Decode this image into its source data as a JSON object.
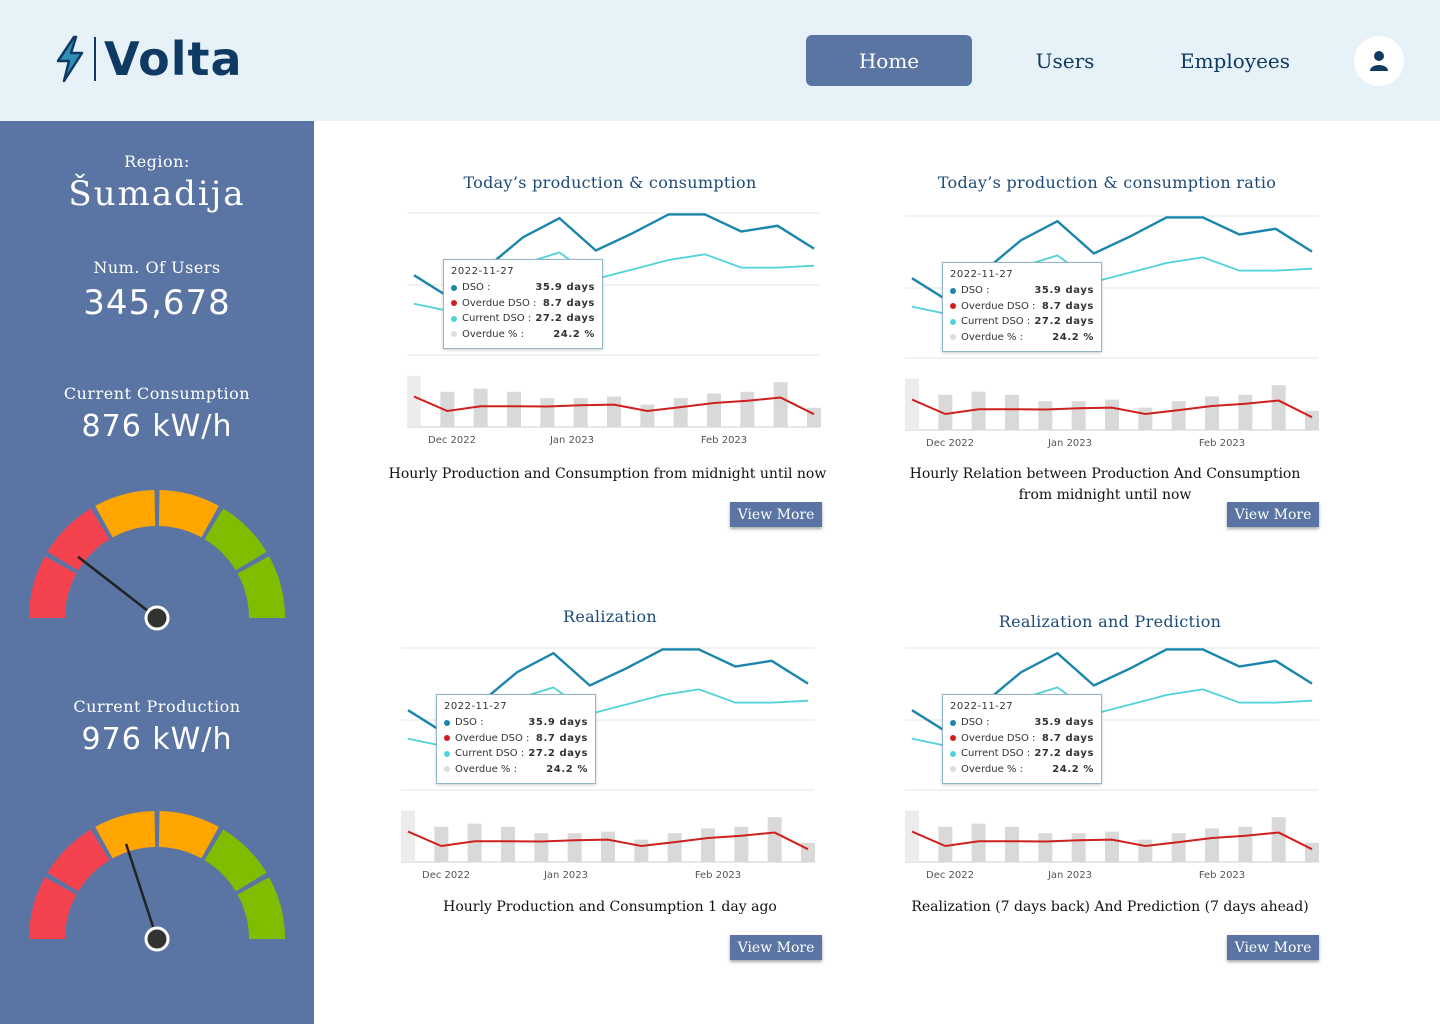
{
  "app": {
    "logo_text": "Volta",
    "brand_color": "#0f3a63",
    "accent_color": "#5a75a3"
  },
  "nav": {
    "items": [
      {
        "label": "Home",
        "active": true
      },
      {
        "label": "Users",
        "active": false
      },
      {
        "label": "Employees",
        "active": false
      }
    ],
    "profile_icon": "user-icon"
  },
  "sidebar": {
    "region_label": "Region:",
    "region_value": "Šumadija",
    "users_label": "Num. Of Users",
    "users_value": "345,678",
    "consumption_label": "Current Consumption",
    "consumption_value": "876 kW/h",
    "production_label": "Current Production",
    "production_value": "976 kW/h",
    "consumption_gauge_level": 0.21,
    "production_gauge_level": 0.4,
    "gauge_colors": [
      "#f5424f",
      "#ffa500",
      "#80bd01"
    ]
  },
  "cards": [
    {
      "title": "Today’s production & consumption",
      "description": "Hourly Production and Consumption from midnight until now",
      "button": "View More"
    },
    {
      "title": "Today’s production & consumption ratio",
      "description": "Hourly Relation between Production And Consumption from midnight until now",
      "button": "View More"
    },
    {
      "title": "Realization",
      "description": "Hourly Production and Consumption 1 day ago",
      "button": "View More"
    },
    {
      "title": "Realization and Prediction",
      "description": "Realization (7 days back) And Prediction (7 days ahead)",
      "button": "View More"
    }
  ],
  "tooltip": {
    "date": "2022-11-27",
    "rows": [
      {
        "name": "DSO :",
        "value": "35.9 days",
        "color": "#1a86ab"
      },
      {
        "name": "Overdue DSO :",
        "value": "8.7 days",
        "color": "#d01f1f"
      },
      {
        "name": "Current DSO :",
        "value": "27.2 days",
        "color": "#4fd3d8"
      },
      {
        "name": "Overdue % :",
        "value": "24.2 %",
        "color": "#dddddd"
      }
    ]
  },
  "chart_data": {
    "type": "line",
    "tick_labels": [
      "Dec 2022",
      "Jan 2023",
      "Feb 2023"
    ],
    "series": [
      {
        "values": [
          42,
          30,
          46,
          62,
          72,
          55,
          64,
          74,
          74,
          65,
          68,
          56
        ],
        "color": "#1a86ab"
      },
      {
        "values": [
          27,
          23,
          36,
          48,
          54,
          40,
          45,
          50,
          53,
          46,
          46,
          47
        ],
        "color": "#4fd3d8"
      },
      {
        "values": [
          9.5,
          5,
          6.5,
          6.5,
          6.4,
          6.8,
          7,
          5,
          6.2,
          7.5,
          8.2,
          9.2,
          4
        ]
      },
      {
        "values": [
          16,
          11,
          12,
          11,
          9,
          9,
          9.5,
          7,
          9,
          10.5,
          11,
          14,
          6
        ]
      }
    ],
    "grid": true
  }
}
